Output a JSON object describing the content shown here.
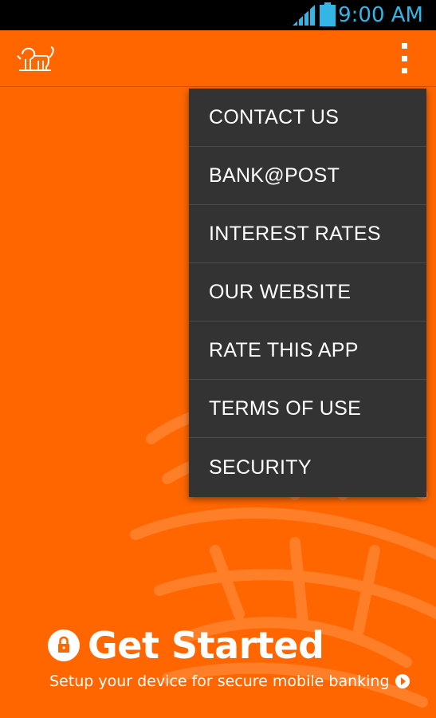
{
  "status_bar": {
    "time": "9:00 AM",
    "signal_icon": "signal-icon",
    "battery_icon": "battery-icon",
    "accent_color": "#33b5e5"
  },
  "app_bar": {
    "logo": "lion-logo",
    "overflow_icon": "overflow-menu-icon",
    "color": "#ff6600"
  },
  "menu": {
    "items": [
      {
        "label": "CONTACT US"
      },
      {
        "label": "BANK@POST"
      },
      {
        "label": "INTEREST RATES"
      },
      {
        "label": "OUR WEBSITE"
      },
      {
        "label": "RATE THIS APP"
      },
      {
        "label": "TERMS OF USE"
      },
      {
        "label": "SECURITY"
      }
    ],
    "background": "#333333"
  },
  "get_started": {
    "title": "Get Started",
    "subtitle": "Setup your device for secure mobile banking",
    "lock_icon": "lock-icon",
    "play_icon": "play-icon"
  }
}
